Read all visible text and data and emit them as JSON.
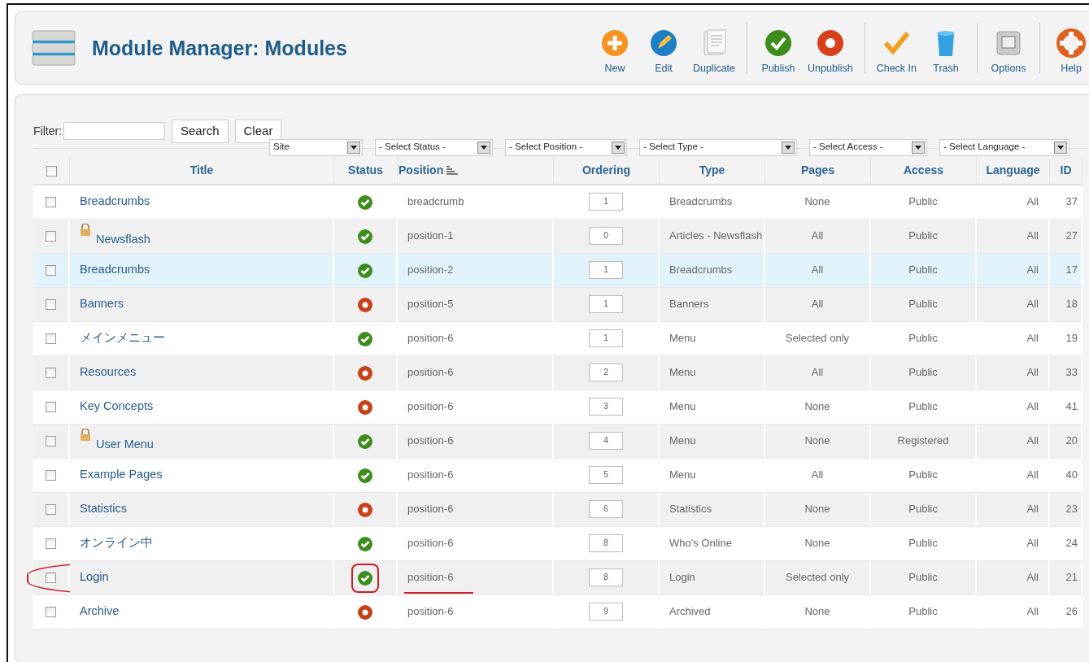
{
  "header": {
    "title": "Module Manager: Modules"
  },
  "toolbar": [
    {
      "label": "New",
      "kind": "new",
      "separator_after": false
    },
    {
      "label": "Edit",
      "kind": "edit",
      "separator_after": false
    },
    {
      "label": "Duplicate",
      "kind": "duplicate",
      "separator_after": true
    },
    {
      "label": "Publish",
      "kind": "publish",
      "separator_after": false
    },
    {
      "label": "Unpublish",
      "kind": "unpublish",
      "separator_after": true
    },
    {
      "label": "Check In",
      "kind": "checkin",
      "separator_after": false
    },
    {
      "label": "Trash",
      "kind": "trash",
      "separator_after": true
    },
    {
      "label": "Options",
      "kind": "options",
      "separator_after": true
    },
    {
      "label": "Help",
      "kind": "help",
      "separator_after": false
    }
  ],
  "filter": {
    "label": "Filter:",
    "buttons": [
      "Search",
      "Clear"
    ]
  },
  "selects": [
    {
      "value": "Site"
    },
    {
      "value": "- Select Status -"
    },
    {
      "value": "- Select Position -"
    },
    {
      "value": "- Select Type -"
    },
    {
      "value": "- Select Access -"
    },
    {
      "value": "- Select Language -"
    }
  ],
  "table": {
    "select_all": {
      "checked": false
    },
    "columns": [
      {
        "label": "Title",
        "sorted": false
      },
      {
        "label": "Status",
        "sorted": false
      },
      {
        "label": "Position",
        "sorted": true
      },
      {
        "label": "Ordering",
        "sorted": false
      },
      {
        "label": "Type",
        "sorted": false
      },
      {
        "label": "Pages",
        "sorted": false
      },
      {
        "label": "Access",
        "sorted": false
      },
      {
        "label": "Language",
        "sorted": false
      },
      {
        "label": "ID",
        "sorted": false
      }
    ],
    "rows": [
      {
        "checked": false,
        "title": "Breadcrumbs",
        "locked": false,
        "published": true,
        "position": "breadcrumb",
        "ordering": "1",
        "type": "Breadcrumbs",
        "pages": "None",
        "access": "Public",
        "language": "All",
        "id": "37",
        "highlighted": false,
        "marked": false
      },
      {
        "checked": false,
        "title": "Newsflash",
        "locked": true,
        "published": true,
        "position": "position-1",
        "ordering": "0",
        "type": "Articles - Newsflash",
        "pages": "All",
        "access": "Public",
        "language": "All",
        "id": "27",
        "highlighted": false,
        "marked": false
      },
      {
        "checked": false,
        "title": "Breadcrumbs",
        "locked": false,
        "published": true,
        "position": "position-2",
        "ordering": "1",
        "type": "Breadcrumbs",
        "pages": "All",
        "access": "Public",
        "language": "All",
        "id": "17",
        "highlighted": true,
        "marked": false
      },
      {
        "checked": false,
        "title": "Banners",
        "locked": false,
        "published": false,
        "position": "position-5",
        "ordering": "1",
        "type": "Banners",
        "pages": "All",
        "access": "Public",
        "language": "All",
        "id": "18",
        "highlighted": false,
        "marked": false
      },
      {
        "checked": false,
        "title": "メインメニュー",
        "locked": false,
        "published": true,
        "position": "position-6",
        "ordering": "1",
        "type": "Menu",
        "pages": "Selected only",
        "access": "Public",
        "language": "All",
        "id": "19",
        "highlighted": false,
        "marked": false
      },
      {
        "checked": false,
        "title": "Resources",
        "locked": false,
        "published": false,
        "position": "position-6",
        "ordering": "2",
        "type": "Menu",
        "pages": "All",
        "access": "Public",
        "language": "All",
        "id": "33",
        "highlighted": false,
        "marked": false
      },
      {
        "checked": false,
        "title": "Key Concepts",
        "locked": false,
        "published": false,
        "position": "position-6",
        "ordering": "3",
        "type": "Menu",
        "pages": "None",
        "access": "Public",
        "language": "All",
        "id": "41",
        "highlighted": false,
        "marked": false
      },
      {
        "checked": false,
        "title": "User Menu",
        "locked": true,
        "published": true,
        "position": "position-6",
        "ordering": "4",
        "type": "Menu",
        "pages": "None",
        "access": "Registered",
        "language": "All",
        "id": "20",
        "highlighted": false,
        "marked": false
      },
      {
        "checked": false,
        "title": "Example Pages",
        "locked": false,
        "published": true,
        "position": "position-6",
        "ordering": "5",
        "type": "Menu",
        "pages": "All",
        "access": "Public",
        "language": "All",
        "id": "40",
        "highlighted": false,
        "marked": false
      },
      {
        "checked": false,
        "title": "Statistics",
        "locked": false,
        "published": false,
        "position": "position-6",
        "ordering": "6",
        "type": "Statistics",
        "pages": "None",
        "access": "Public",
        "language": "All",
        "id": "23",
        "highlighted": false,
        "marked": false
      },
      {
        "checked": false,
        "title": "オンライン中",
        "locked": false,
        "published": true,
        "position": "position-6",
        "ordering": "8",
        "type": "Who's Online",
        "pages": "None",
        "access": "Public",
        "language": "All",
        "id": "24",
        "highlighted": false,
        "marked": false
      },
      {
        "checked": false,
        "title": "Login",
        "locked": false,
        "published": true,
        "position": "position-6",
        "ordering": "8",
        "type": "Login",
        "pages": "Selected only",
        "access": "Public",
        "language": "All",
        "id": "21",
        "highlighted": false,
        "marked": true
      },
      {
        "checked": false,
        "title": "Archive",
        "locked": false,
        "published": false,
        "position": "position-6",
        "ordering": "9",
        "type": "Archived",
        "pages": "None",
        "access": "Public",
        "language": "All",
        "id": "26",
        "highlighted": false,
        "marked": false
      }
    ]
  }
}
